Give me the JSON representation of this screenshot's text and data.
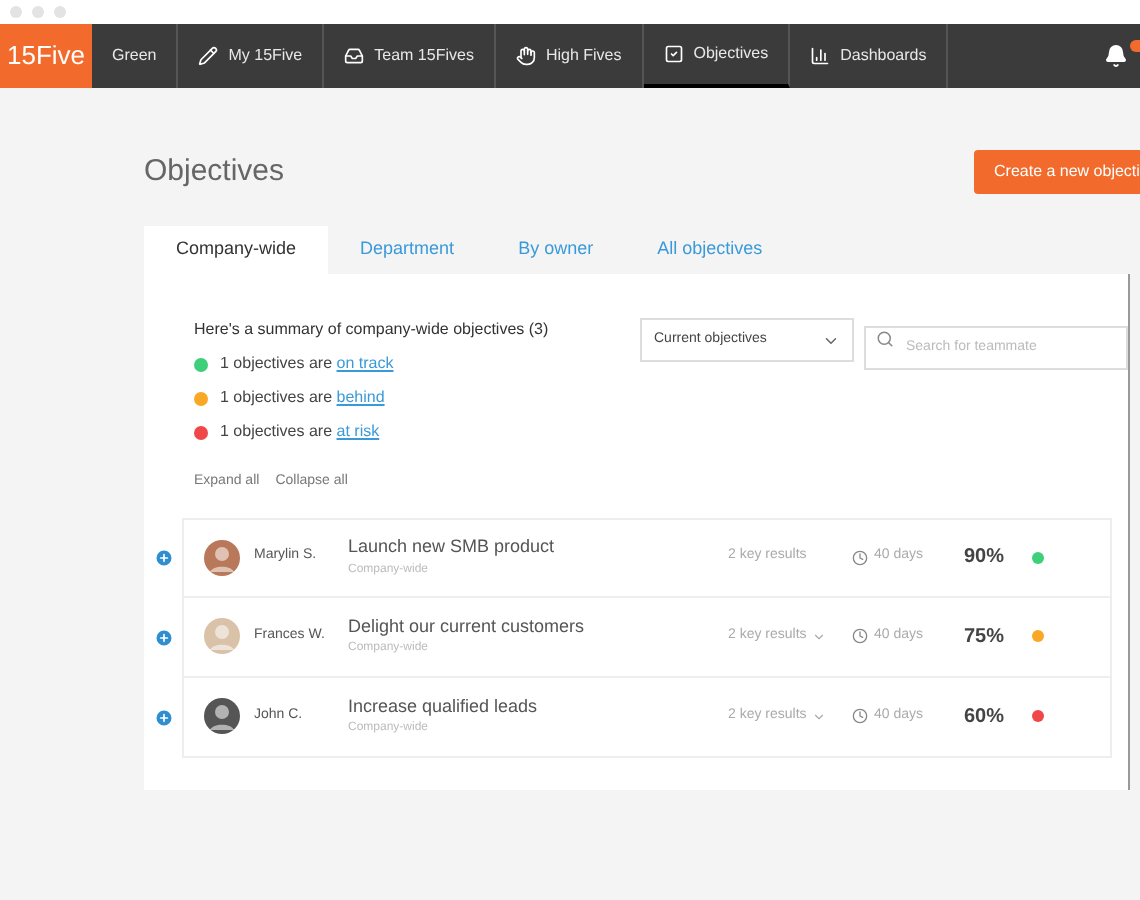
{
  "nav": {
    "logo": "15Five",
    "items": [
      {
        "label": "Green",
        "selected": false
      },
      {
        "label": "My 15Five",
        "selected": false
      },
      {
        "label": "Team 15Fives",
        "selected": false
      },
      {
        "label": "High Fives",
        "selected": false
      },
      {
        "label": "Objectives",
        "selected": true
      },
      {
        "label": "Dashboards",
        "selected": false
      }
    ]
  },
  "page": {
    "title": "Objectives",
    "create_button": "Create a new objecti"
  },
  "tabs": [
    {
      "label": "Company-wide",
      "selected": true
    },
    {
      "label": "Department",
      "selected": false
    },
    {
      "label": "By owner",
      "selected": false
    },
    {
      "label": "All objectives",
      "selected": false
    }
  ],
  "summary": {
    "heading": "Here's a summary of company-wide objectives (3)",
    "items": [
      {
        "text": "1 objectives are ",
        "link": "on track",
        "color": "#3ecf7b"
      },
      {
        "text": "1 objectives are ",
        "link": "behind",
        "color": "#f9a825"
      },
      {
        "text": "1 objectives are ",
        "link": "at risk",
        "color": "#f04848"
      }
    ]
  },
  "filter": {
    "value": "Current objectives"
  },
  "search": {
    "placeholder": "Search for teammate"
  },
  "expand_all": "Expand all",
  "collapse_all": "Collapse all",
  "objectives": [
    {
      "owner": "Marylin S.",
      "title": "Launch new SMB product",
      "scope": "Company-wide",
      "key_results": "2 key results",
      "menu": false,
      "due": "40 days",
      "progress": "90%",
      "color": "#3ecf7b"
    },
    {
      "owner": "Frances W.",
      "title": "Delight our current customers",
      "scope": "Company-wide",
      "key_results": "2 key results",
      "menu": true,
      "due": "40 days",
      "progress": "75%",
      "color": "#f9a825"
    },
    {
      "owner": "John C.",
      "title": "Increase qualified leads",
      "scope": "Company-wide",
      "key_results": "2 key results",
      "menu": true,
      "due": "40 days",
      "progress": "60%",
      "color": "#f04848"
    }
  ]
}
